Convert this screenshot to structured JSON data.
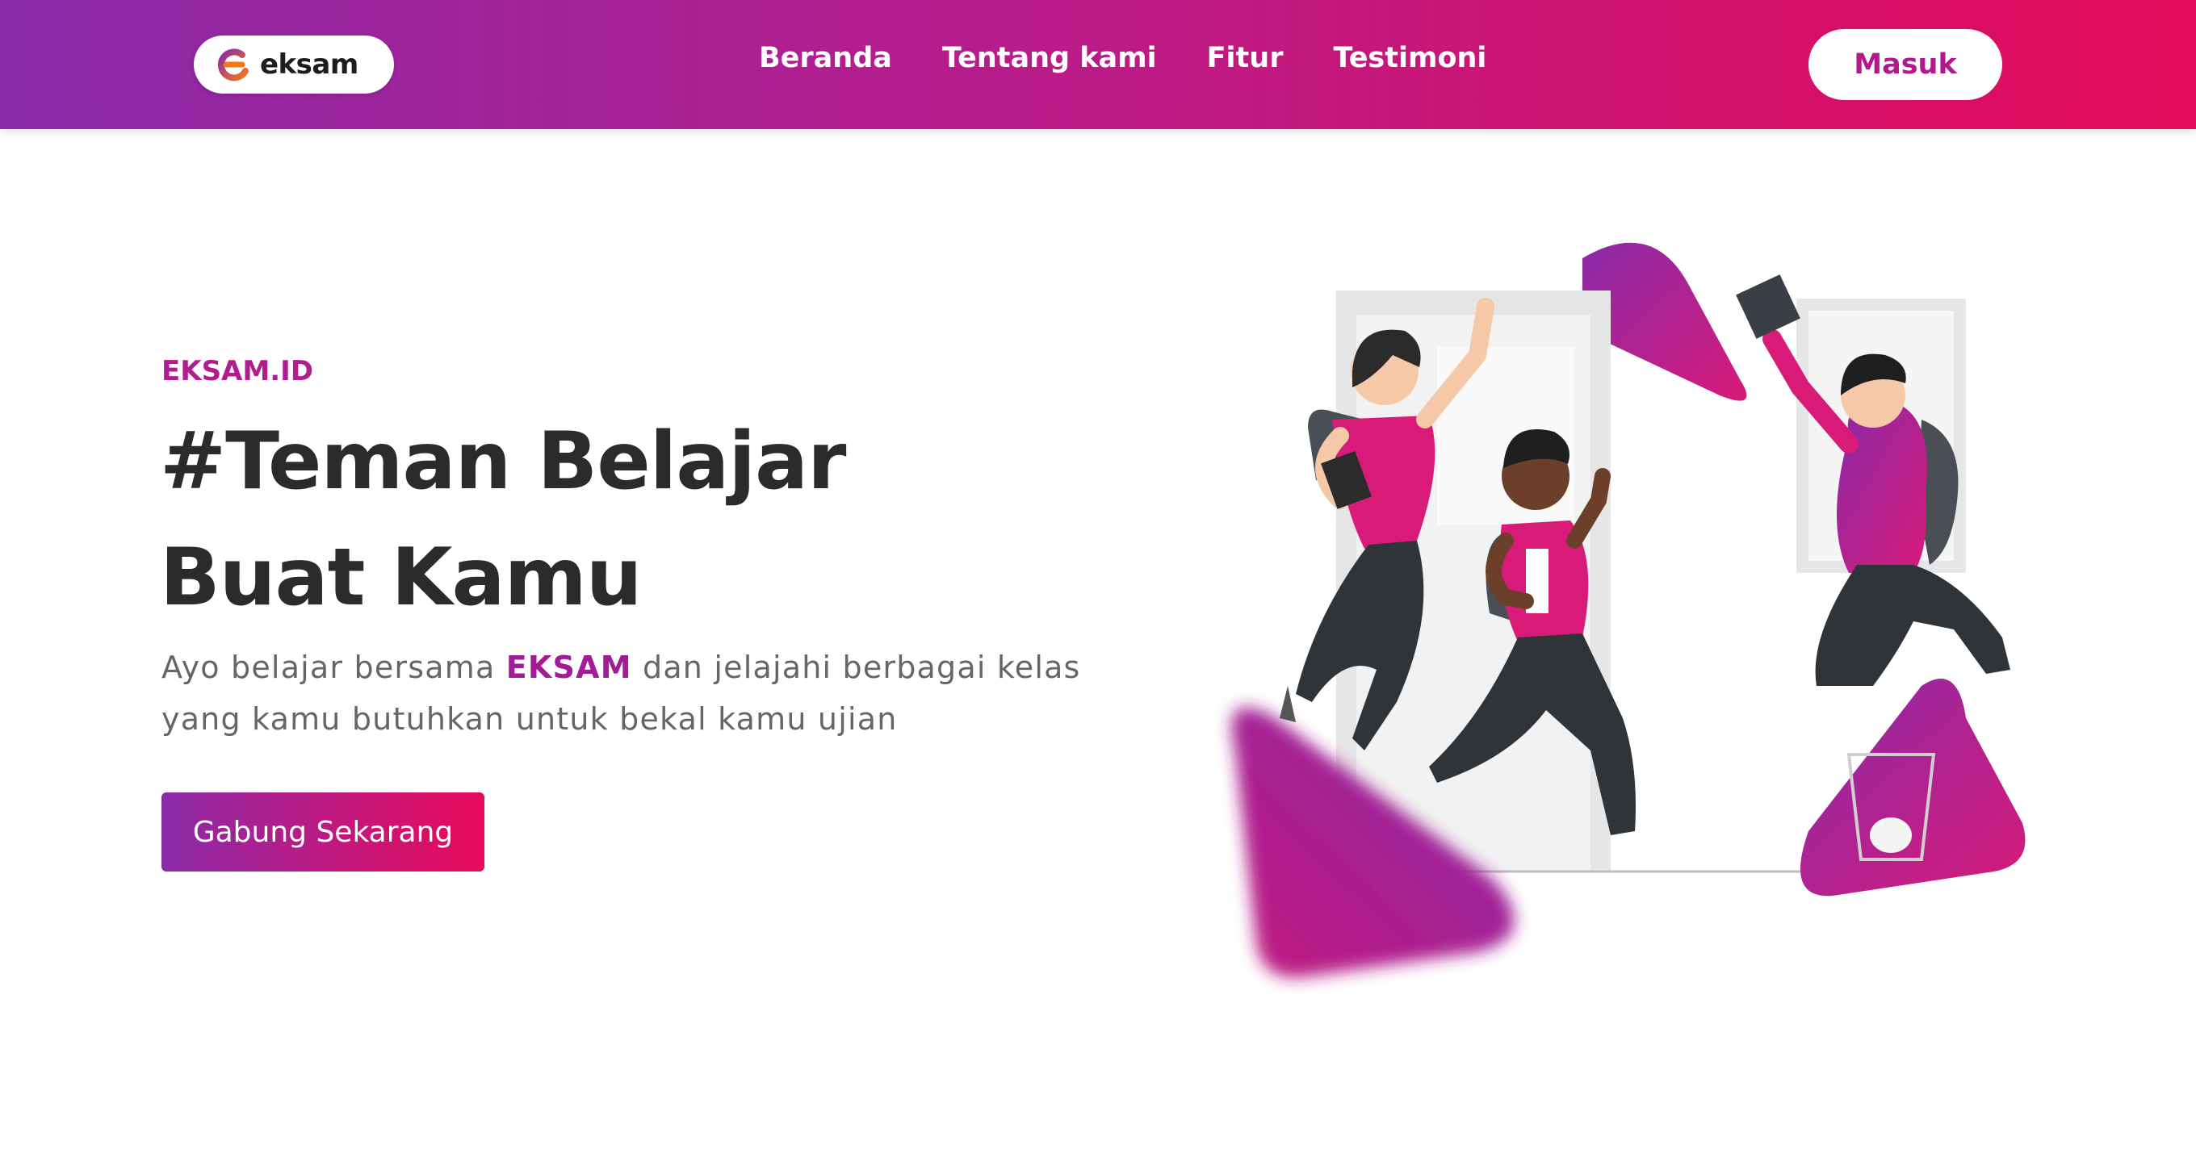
{
  "header": {
    "logo_text": "eksam",
    "nav": [
      "Beranda",
      "Tentang kami",
      "Fitur",
      "Testimoni"
    ],
    "login_label": "Masuk"
  },
  "hero": {
    "eyebrow": "EKSAM.ID",
    "headline_line1": "#Teman Belajar",
    "headline_line2": "Buat Kamu",
    "subtitle_part1": "Ayo belajar bersama ",
    "subtitle_brand": "EKSAM",
    "subtitle_part2": " dan jelajahi berbagai kelas",
    "subtitle_line2": "yang kamu butuhkan untuk bekal kamu ujian",
    "cta_label": "Gabung Sekarang"
  },
  "icons": {
    "logo": "eksam-logo-icon"
  },
  "colors": {
    "gradient_start": "#8a2aa8",
    "gradient_end": "#e40b5a",
    "accent": "#b01d8e",
    "heading": "#2b2b2b",
    "body_text": "#666666"
  }
}
